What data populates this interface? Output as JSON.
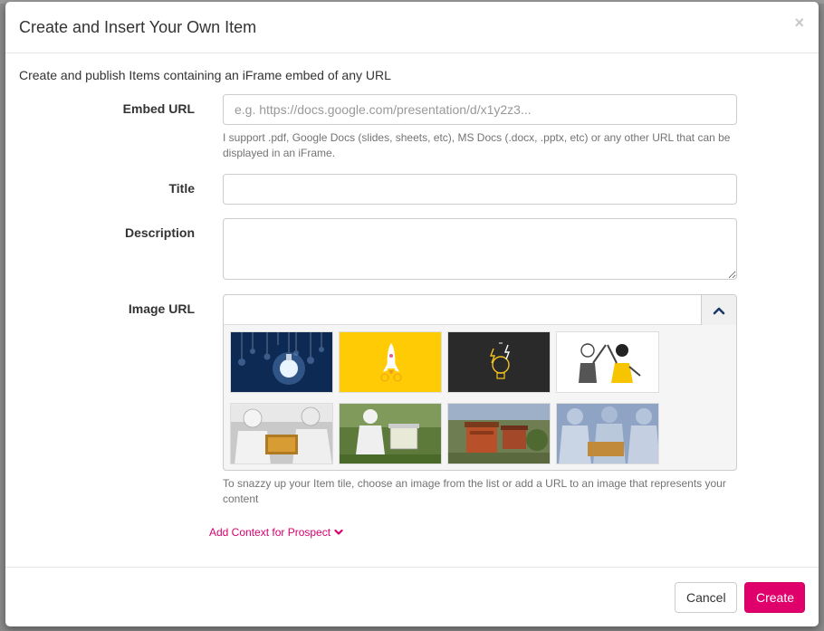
{
  "modal": {
    "title": "Create and Insert Your Own Item",
    "close": "×",
    "intro": "Create and publish Items containing an iFrame embed of any URL"
  },
  "form": {
    "embed_url": {
      "label": "Embed URL",
      "placeholder": "e.g. https://docs.google.com/presentation/d/x1y2z3...",
      "value": "",
      "help": "I support .pdf, Google Docs (slides, sheets, etc), MS Docs (.docx, .pptx, etc) or any other URL that can be displayed in an iFrame."
    },
    "title": {
      "label": "Title",
      "value": ""
    },
    "description": {
      "label": "Description",
      "value": ""
    },
    "image_url": {
      "label": "Image URL",
      "value": "",
      "toggle_icon": "chevron-up-icon",
      "help": "To snazzy up your Item tile, choose an image from the list or add a URL to an image that represents your content"
    }
  },
  "thumbnails": [
    {
      "name": "lightbulbs-dark-blue"
    },
    {
      "name": "rocket-yellow"
    },
    {
      "name": "lightbulb-lightning-dark"
    },
    {
      "name": "people-high-five"
    },
    {
      "name": "beekeepers-frame"
    },
    {
      "name": "beekeeper-hive-garden"
    },
    {
      "name": "beehives-garden"
    },
    {
      "name": "beekeepers-group"
    }
  ],
  "add_context": {
    "label": "Add Context for Prospect",
    "icon": "chevron-down-icon"
  },
  "footer": {
    "cancel_label": "Cancel",
    "create_label": "Create"
  },
  "colors": {
    "accent": "#e0006b",
    "link": "#d6006e",
    "chevron": "#1c3a66"
  }
}
